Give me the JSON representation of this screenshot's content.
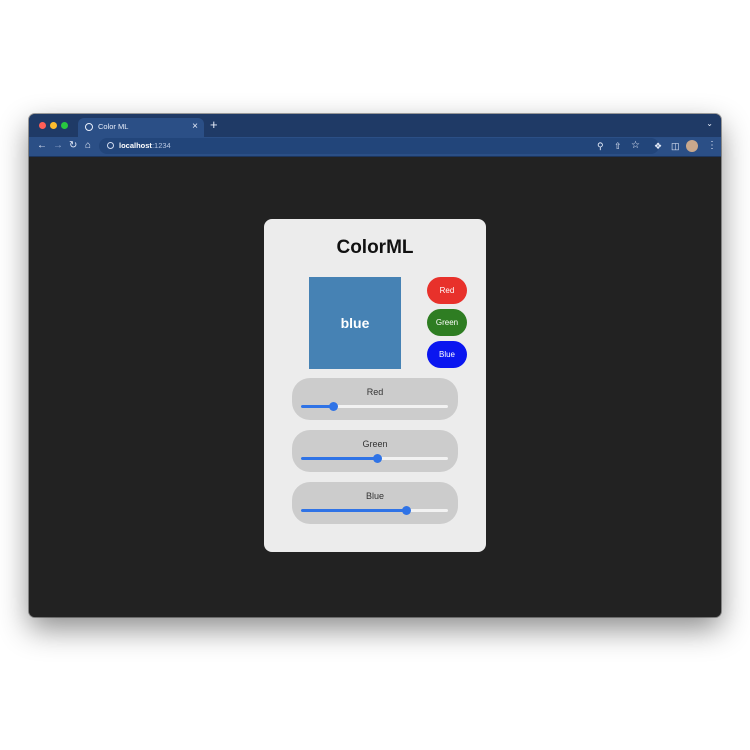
{
  "browser": {
    "tab_title": "Color ML",
    "tab_close": "×",
    "new_tab": "+",
    "url_host": "localhost",
    "url_port": ":1234",
    "icons": {
      "back": "back-arrow-icon",
      "forward": "forward-arrow-icon",
      "reload": "reload-icon",
      "home": "home-icon",
      "zoom": "zoom-icon",
      "share": "share-icon",
      "bookmark": "star-icon",
      "extensions": "puzzle-icon",
      "sidepanel": "side-panel-icon",
      "profile": "avatar-icon",
      "menu": "kebab-menu-icon"
    }
  },
  "app": {
    "title": "ColorML",
    "swatch": {
      "label": "blue",
      "color": "#4682b4"
    },
    "buttons": [
      {
        "label": "Red",
        "color": "#e8312b"
      },
      {
        "label": "Green",
        "color": "#2e7d22"
      },
      {
        "label": "Blue",
        "color": "#0a16f0"
      }
    ],
    "sliders": [
      {
        "label": "Red",
        "value": 0.22
      },
      {
        "label": "Green",
        "value": 0.52
      },
      {
        "label": "Blue",
        "value": 0.72
      }
    ],
    "accent_color": "#2f73e6"
  }
}
